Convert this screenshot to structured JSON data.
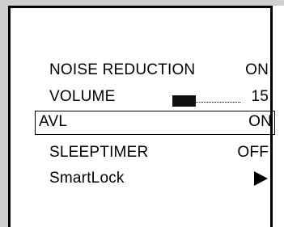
{
  "menu": {
    "items": [
      {
        "label": "NOISE REDUCTION",
        "value": "ON"
      },
      {
        "label": "VOLUME",
        "value": "15",
        "level_percent": 35
      },
      {
        "label": "AVL",
        "value": "ON",
        "selected": true
      },
      {
        "label": "SLEEPTIMER",
        "value": "OFF"
      },
      {
        "label": "SmartLock",
        "icon": "right-arrow-icon"
      }
    ]
  },
  "colors": {
    "frame": "#c8c8c8",
    "text": "#000000",
    "background": "#ffffff"
  }
}
